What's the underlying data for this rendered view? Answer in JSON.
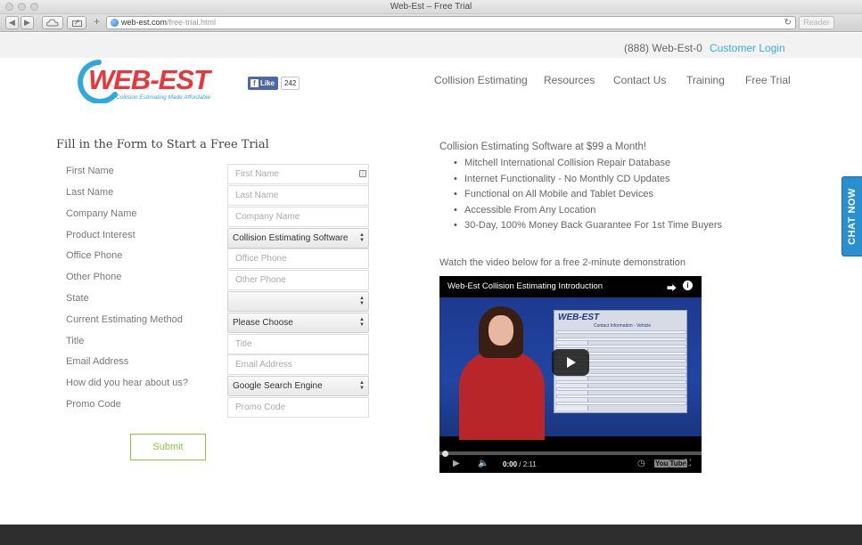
{
  "window": {
    "title": "Web-Est – Free Trial"
  },
  "browser": {
    "url_domain": "web-est.com",
    "url_path": "/free-trial.html",
    "reader_label": "Reader",
    "back_label": "◀",
    "forward_label": "▶",
    "add_label": "+"
  },
  "topbar": {
    "phone": "(888) Web-Est-0",
    "customer_login": "Customer Login"
  },
  "header": {
    "logo_text": "WEB-EST",
    "logo_tagline": "Collision Estimating Made Affordable",
    "fb_like_label": "Like",
    "fb_like_count": "242"
  },
  "nav": {
    "items": [
      {
        "label": "Collision Estimating"
      },
      {
        "label": "Resources"
      },
      {
        "label": "Contact Us"
      },
      {
        "label": "Training"
      },
      {
        "label": "Free Trial"
      }
    ]
  },
  "form": {
    "title": "Fill in the Form to Start a Free Trial",
    "submit_label": "Submit",
    "fields": [
      {
        "label": "First Name",
        "placeholder": "First Name"
      },
      {
        "label": "Last Name",
        "placeholder": "Last Name"
      },
      {
        "label": "Company Name",
        "placeholder": "Company Name"
      },
      {
        "label": "Product Interest",
        "value": "Collision Estimating Software"
      },
      {
        "label": "Office Phone",
        "placeholder": "Office Phone"
      },
      {
        "label": "Other Phone",
        "placeholder": "Other Phone"
      },
      {
        "label": "State",
        "value": ""
      },
      {
        "label": "Current Estimating Method",
        "value": "Please Choose"
      },
      {
        "label": "Title",
        "placeholder": "Title"
      },
      {
        "label": "Email Address",
        "placeholder": "Email Address"
      },
      {
        "label": "How did you hear about us?",
        "value": "Google Search Engine"
      },
      {
        "label": "Promo Code",
        "placeholder": "Promo Code"
      }
    ]
  },
  "promo": {
    "title": "Collision Estimating Software at $99 a Month!",
    "bullets": [
      "Mitchell International Collision Repair Database",
      "Internet Functionality - No Monthly CD Updates",
      "Functional on All Mobile and Tablet Devices",
      "Accessible From Any Location",
      "30-Day, 100% Money Back Guarantee For 1st Time Buyers"
    ],
    "video_caption": "Watch the video below for a free 2-minute demonstration"
  },
  "video": {
    "title": "Web-Est Collision Estimating Introduction",
    "current_time": "0:00",
    "total_time": "/ 2:11",
    "screen_logo": "WEB-EST",
    "screen_heading": "Contact Information - Vehicle",
    "youtube_label_a": "You",
    "youtube_label_b": "Tube",
    "progress": 0
  },
  "chat": {
    "label": "CHAT NOW"
  },
  "colors": {
    "accent": "#36aee0",
    "submit_green": "#8cc63f",
    "logo_red": "#e8373a",
    "logo_blue": "#2fa8e0"
  },
  "icons": {
    "share": "share-icon",
    "info": "info-icon",
    "play": "play-icon",
    "volume": "volume-icon",
    "fullscreen": "fullscreen-icon"
  }
}
